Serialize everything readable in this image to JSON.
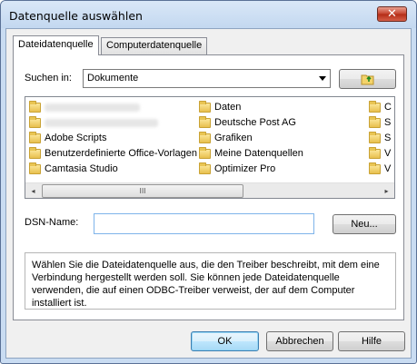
{
  "window": {
    "title": "Datenquelle auswählen",
    "close_glyph": "✕"
  },
  "tabs": [
    {
      "label": "Dateidatenquelle",
      "active": true
    },
    {
      "label": "Computerdatenquelle",
      "active": false
    }
  ],
  "search_in": {
    "label": "Suchen in:",
    "value": "Dokumente",
    "up_folder_icon": "folder-up-icon"
  },
  "file_list": {
    "column1": [
      {
        "label": "",
        "redacted": true
      },
      {
        "label": "",
        "redacted": true
      },
      {
        "label": "Adobe Scripts"
      },
      {
        "label": "Benutzerdefinierte Office-Vorlagen"
      },
      {
        "label": "Camtasia Studio"
      }
    ],
    "column2": [
      {
        "label": "Daten"
      },
      {
        "label": "Deutsche Post AG"
      },
      {
        "label": "Grafiken"
      },
      {
        "label": "Meine Datenquellen"
      },
      {
        "label": "Optimizer Pro"
      }
    ],
    "column3_partial": [
      "C",
      "S",
      "S",
      "V",
      "V"
    ],
    "scrollbar": {
      "left_arrow": "◂",
      "right_arrow": "▸",
      "thumb_grip": "III"
    }
  },
  "dsn": {
    "label": "DSN-Name:",
    "value": "",
    "new_button": "Neu..."
  },
  "description": "Wählen Sie die Dateidatenquelle aus, die den Treiber beschreibt, mit dem eine Verbindung hergestellt werden soll. Sie können jede Dateidatenquelle verwenden, die auf einen ODBC-Treiber verweist, der auf dem Computer installiert ist.",
  "buttons": {
    "ok": "OK",
    "cancel": "Abbrechen",
    "help": "Hilfe"
  },
  "colors": {
    "title_bar": "#c9dcf2",
    "close_button": "#c4402b",
    "focus_border": "#7eb4ea"
  }
}
